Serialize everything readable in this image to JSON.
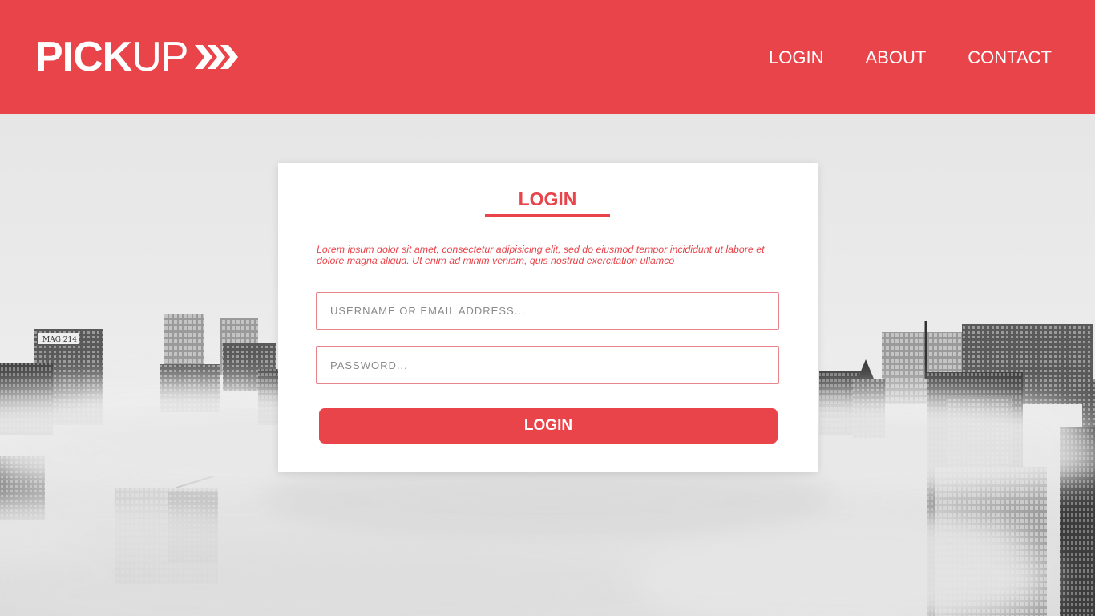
{
  "header": {
    "logo": {
      "bold": "PICK",
      "light": "UP",
      "icon": "chevrons-right-icon"
    },
    "nav": [
      {
        "label": "LOGIN"
      },
      {
        "label": "ABOUT"
      },
      {
        "label": "CONTACT"
      }
    ]
  },
  "background": {
    "building_sign": "MAG 214"
  },
  "login": {
    "title": "LOGIN",
    "description": "Lorem ipsum dolor sit amet, consectetur adipisicing elit, sed do eiusmod tempor incididunt ut labore et dolore magna aliqua. Ut enim ad minim veniam, quis nostrud exercitation ullamco",
    "username_placeholder": "USERNAME OR EMAIL ADDRESS...",
    "password_placeholder": "PASSWORD...",
    "submit_label": "LOGIN"
  },
  "colors": {
    "accent": "#e8444a",
    "card": "#ffffff",
    "field_border": "#e8848a"
  }
}
